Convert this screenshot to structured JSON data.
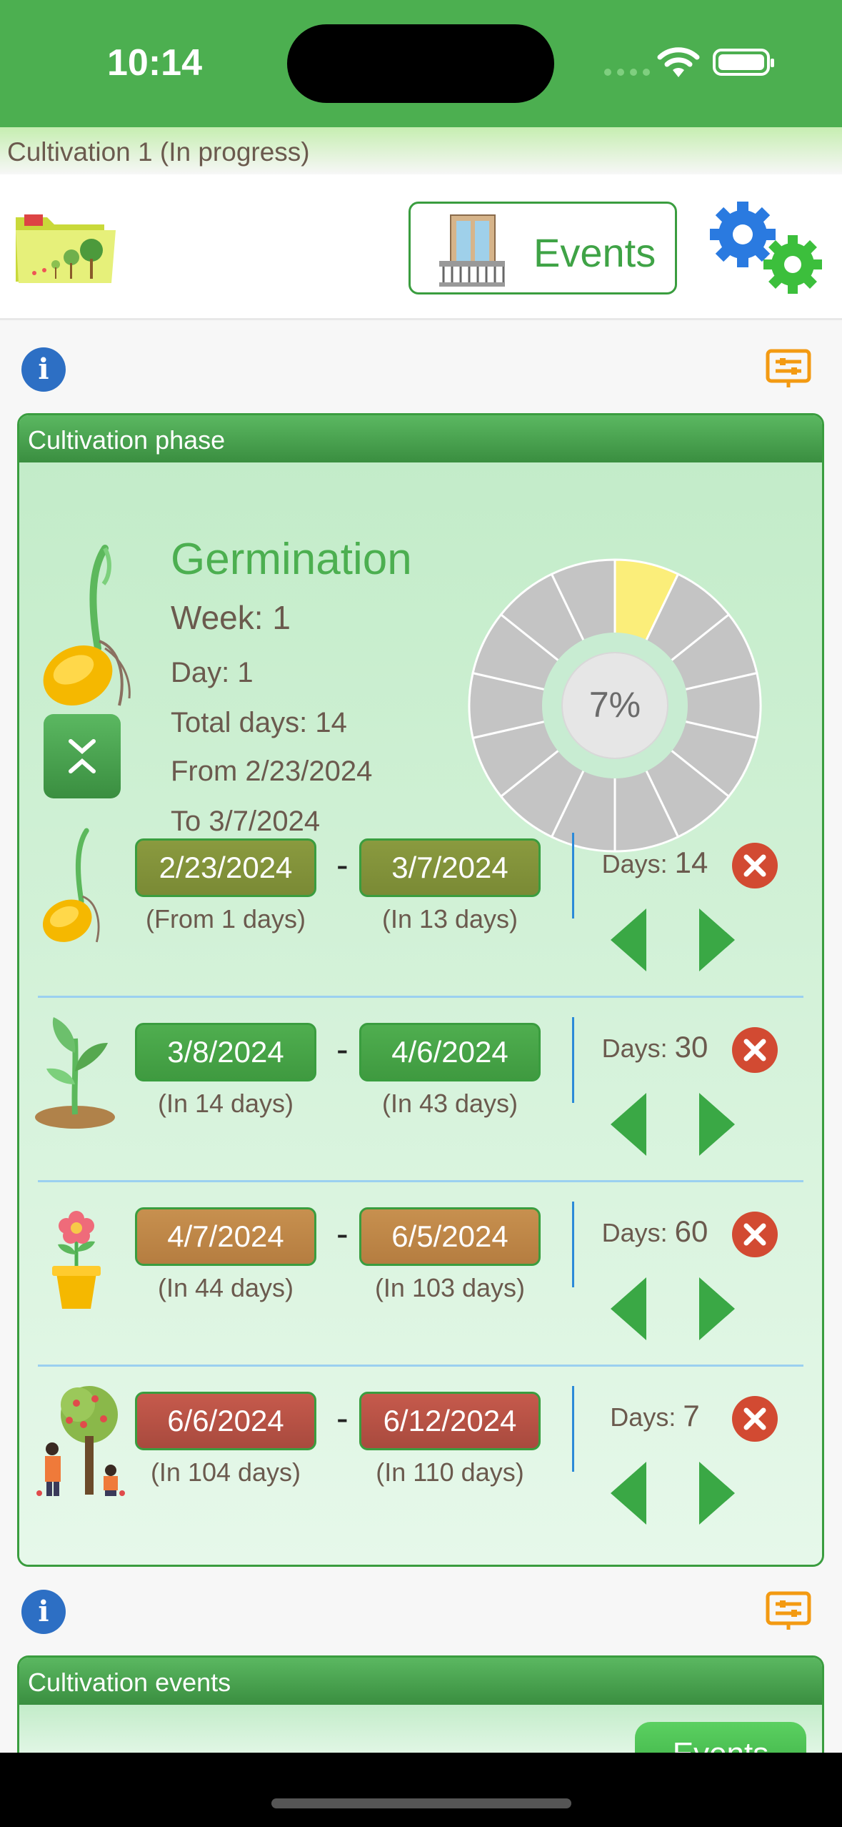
{
  "status_bar": {
    "time": "10:14"
  },
  "title": "Cultivation 1 (In progress)",
  "toolbar": {
    "events_label": "Events"
  },
  "phase_panel": {
    "title": "Cultivation phase",
    "phase_name": "Germination",
    "week": "Week: 1",
    "day": "Day: 1",
    "total_days": "Total days: 14",
    "from": "From 2/23/2024",
    "to": "To 3/7/2024",
    "progress_label": "7%",
    "progress_value": 0.07,
    "donut_segments": 14,
    "donut_active_segments": 1
  },
  "phases": [
    {
      "icon": "seedling-sprout-icon",
      "start": "2/23/2024",
      "start_sub": "(From 1 days)",
      "end": "3/7/2024",
      "end_sub": "(In 13 days)",
      "days_label": "Days:",
      "days": "14",
      "color_top": "#8a9a3f",
      "color_bottom": "#7a8a35"
    },
    {
      "icon": "young-plant-icon",
      "start": "3/8/2024",
      "start_sub": "(In 14 days)",
      "end": "4/6/2024",
      "end_sub": "(In 43 days)",
      "days_label": "Days:",
      "days": "30",
      "color_top": "#4fae4f",
      "color_bottom": "#3f9a40"
    },
    {
      "icon": "flower-pot-icon",
      "start": "4/7/2024",
      "start_sub": "(In 44 days)",
      "end": "6/5/2024",
      "end_sub": "(In 103 days)",
      "days_label": "Days:",
      "days": "60",
      "color_top": "#c7904f",
      "color_bottom": "#b57d40"
    },
    {
      "icon": "harvest-tree-icon",
      "start": "6/6/2024",
      "start_sub": "(In 104 days)",
      "end": "6/12/2024",
      "end_sub": "(In 110 days)",
      "days_label": "Days:",
      "days": "7",
      "color_top": "#c65a4c",
      "color_bottom": "#a84a3e"
    }
  ],
  "events_panel": {
    "title": "Cultivation events",
    "button_label": "Events"
  }
}
